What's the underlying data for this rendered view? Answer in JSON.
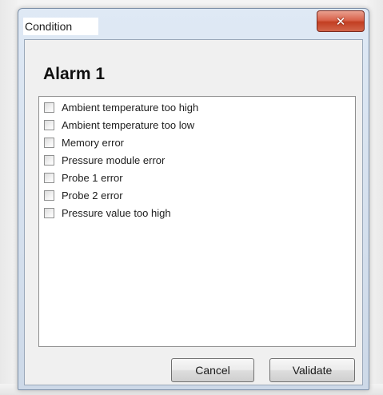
{
  "window": {
    "title": "Condition",
    "close_icon": "close-icon",
    "close_glyph": "✕"
  },
  "dialog": {
    "heading": "Alarm 1",
    "conditions": [
      {
        "label": "Ambient temperature too high",
        "checked": false
      },
      {
        "label": "Ambient temperature too low",
        "checked": false
      },
      {
        "label": "Memory error",
        "checked": false
      },
      {
        "label": "Pressure module error",
        "checked": false
      },
      {
        "label": "Probe 1 error",
        "checked": false
      },
      {
        "label": "Probe 2 error",
        "checked": false
      },
      {
        "label": "Pressure value too high",
        "checked": false
      }
    ]
  },
  "buttons": {
    "cancel_label": "Cancel",
    "validate_label": "Validate"
  },
  "colors": {
    "close_button": "#c8452a",
    "frame": "#d3deec"
  }
}
